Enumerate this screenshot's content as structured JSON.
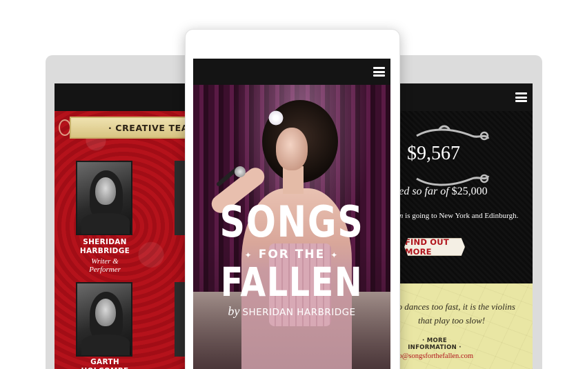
{
  "left_tablet": {
    "section_title": "· CREATIVE TEAM",
    "members": [
      {
        "name_line1": "SHERIDAN",
        "name_line2": "HARBRIDGE",
        "role_line1": "Writer &",
        "role_line2": "Performer"
      },
      {
        "name_line1": "GARTH HOLCOMBE"
      }
    ]
  },
  "phone": {
    "title_line1": "SONGS",
    "title_line2": "FOR THE",
    "title_line3": "FALLEN",
    "byline_prefix": "by",
    "byline_author": "SHERIDAN HARBRIDGE"
  },
  "right_tablet": {
    "amount_raised": "$9,567",
    "raised_suffix_italic": "sed so far of",
    "raised_goal": "$25,000",
    "tour_italic": "en",
    "tour_text": " is going to New York and Edinburgh.",
    "cta_label": "FIND OUT MORE",
    "quote_line1": "ho dances too fast, it is the violins",
    "quote_line2": "that play too slow!",
    "more_info_label": "· MORE INFORMATION ·",
    "contact_email": "fo@songsforthefallen.com"
  },
  "colors": {
    "brand_red": "#b0141c",
    "topbar": "#141414",
    "quote_panel": "#e9e6a4"
  },
  "icons": {
    "menu": "hamburger-menu-icon"
  }
}
